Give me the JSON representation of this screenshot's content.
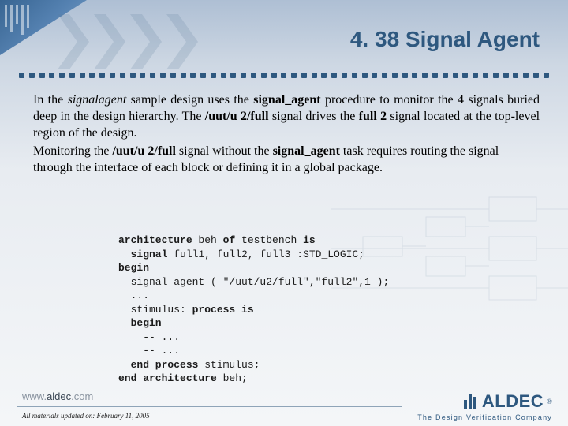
{
  "title": "4. 38  Signal Agent",
  "body": {
    "p1_pre": "In the ",
    "p1_em": "signalagent",
    "p1_mid1": " sample design uses the ",
    "p1_b1": "signal_agent",
    "p1_mid2": " procedure to monitor the 4 signals buried deep in the design hierarchy. The ",
    "p1_b2": "/uut/u 2/full",
    "p1_mid3": " signal drives the ",
    "p1_b3": "full 2",
    "p1_mid4": " signal located at the top-level region of the design.",
    "p2_pre": "Monitoring the ",
    "p2_b1": "/uut/u 2/full",
    "p2_mid1": " signal without the ",
    "p2_b2": "signal_agent",
    "p2_mid2": " task requires routing the signal through the interface of each block or defining it in a global package."
  },
  "code": {
    "l1a": "architecture",
    "l1b": " beh ",
    "l1c": "of",
    "l1d": " testbench ",
    "l1e": "is",
    "l2a": "  signal",
    "l2b": " full1, full2, full3 :STD_LOGIC;",
    "l3a": "begin",
    "l4": "  signal_agent ( \"/uut/u2/full\",\"full2\",1 );",
    "l5": "  ...",
    "l6a": "  stimulus: ",
    "l6b": "process is",
    "l7a": "  begin",
    "l8": "    -- ...",
    "l9": "    -- ...",
    "l10a": "  end process",
    "l10b": " stimulus;",
    "l11a": "end architecture",
    "l11b": " beh;"
  },
  "footer": {
    "url_pre": "www.",
    "url_main": "aldec",
    "url_post": ".com",
    "updated": "All materials updated on: February 11, 2005",
    "logo_text": "ALDEC",
    "logo_r": "®",
    "tagline": "The Design Verification Company"
  }
}
